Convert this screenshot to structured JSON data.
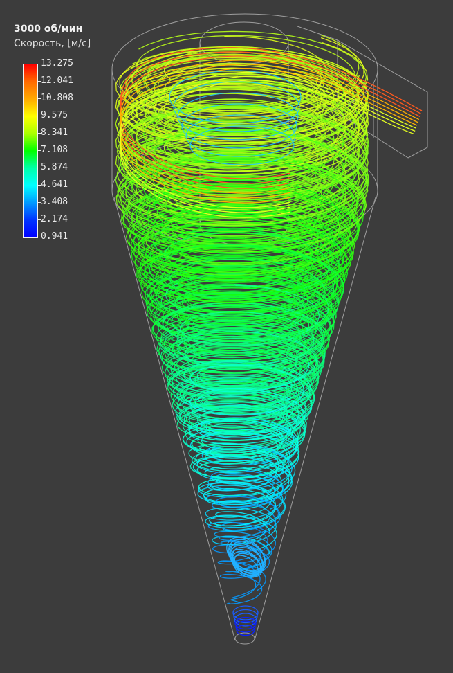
{
  "legend": {
    "title": "3000 об/мин",
    "subtitle": "Скорость, [м/с]",
    "ticks": [
      "13.275",
      "12.041",
      "10.808",
      "9.575",
      "8.341",
      "7.108",
      "5.874",
      "4.641",
      "3.408",
      "2.174",
      "0.941"
    ],
    "gradient_colors": [
      "#ff0000",
      "#ff6a00",
      "#ffaa00",
      "#ffff00",
      "#aaff00",
      "#00ff00",
      "#00ffaa",
      "#00ffff",
      "#0099ff",
      "#0033ff",
      "#0000ff"
    ]
  },
  "colors": {
    "background": "#3c3c3c",
    "outline": "#b4b4b4"
  }
}
